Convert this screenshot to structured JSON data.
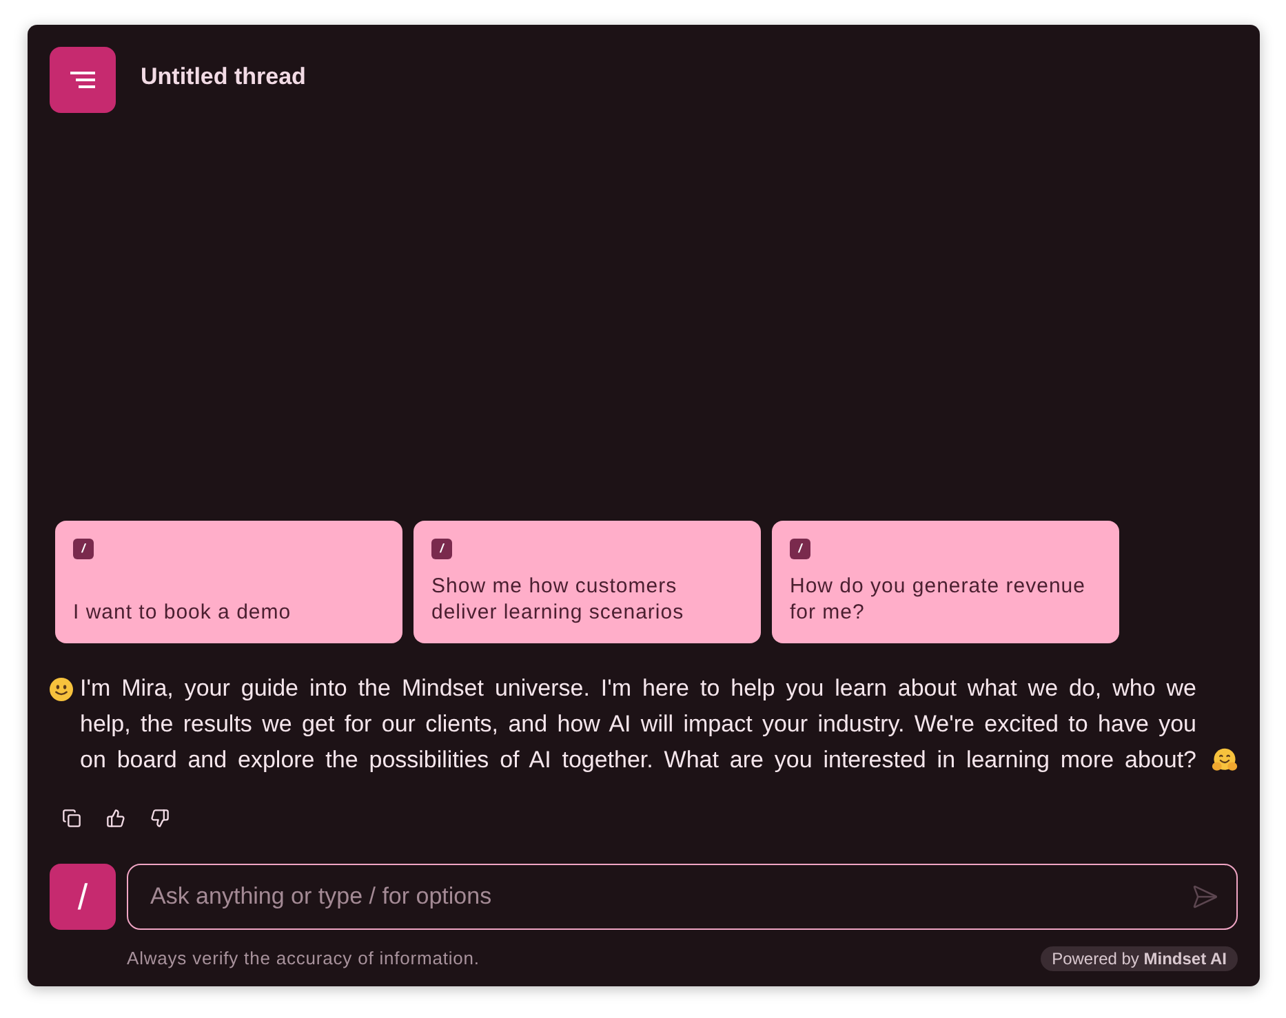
{
  "thread": {
    "title": "Untitled thread"
  },
  "suggestions": [
    {
      "badge": "/",
      "text": "I want to book a demo"
    },
    {
      "badge": "/",
      "text": "Show me how customers deliver learning scenarios"
    },
    {
      "badge": "/",
      "text": "How do you generate revenue for me?"
    }
  ],
  "message": {
    "text": "I'm Mira, your guide into the Mindset universe. I'm here to help you learn about what we do, who we help, the results we get for our clients, and how AI will impact your industry. We're excited to have you on board and explore the possibilities of AI together. What are you interested in learning more about?"
  },
  "composer": {
    "command_key": "/",
    "placeholder": "Ask anything or type / for options"
  },
  "footer": {
    "disclaimer": "Always verify the accuracy of information.",
    "powered_by": "Powered by **Mindset AI**"
  }
}
